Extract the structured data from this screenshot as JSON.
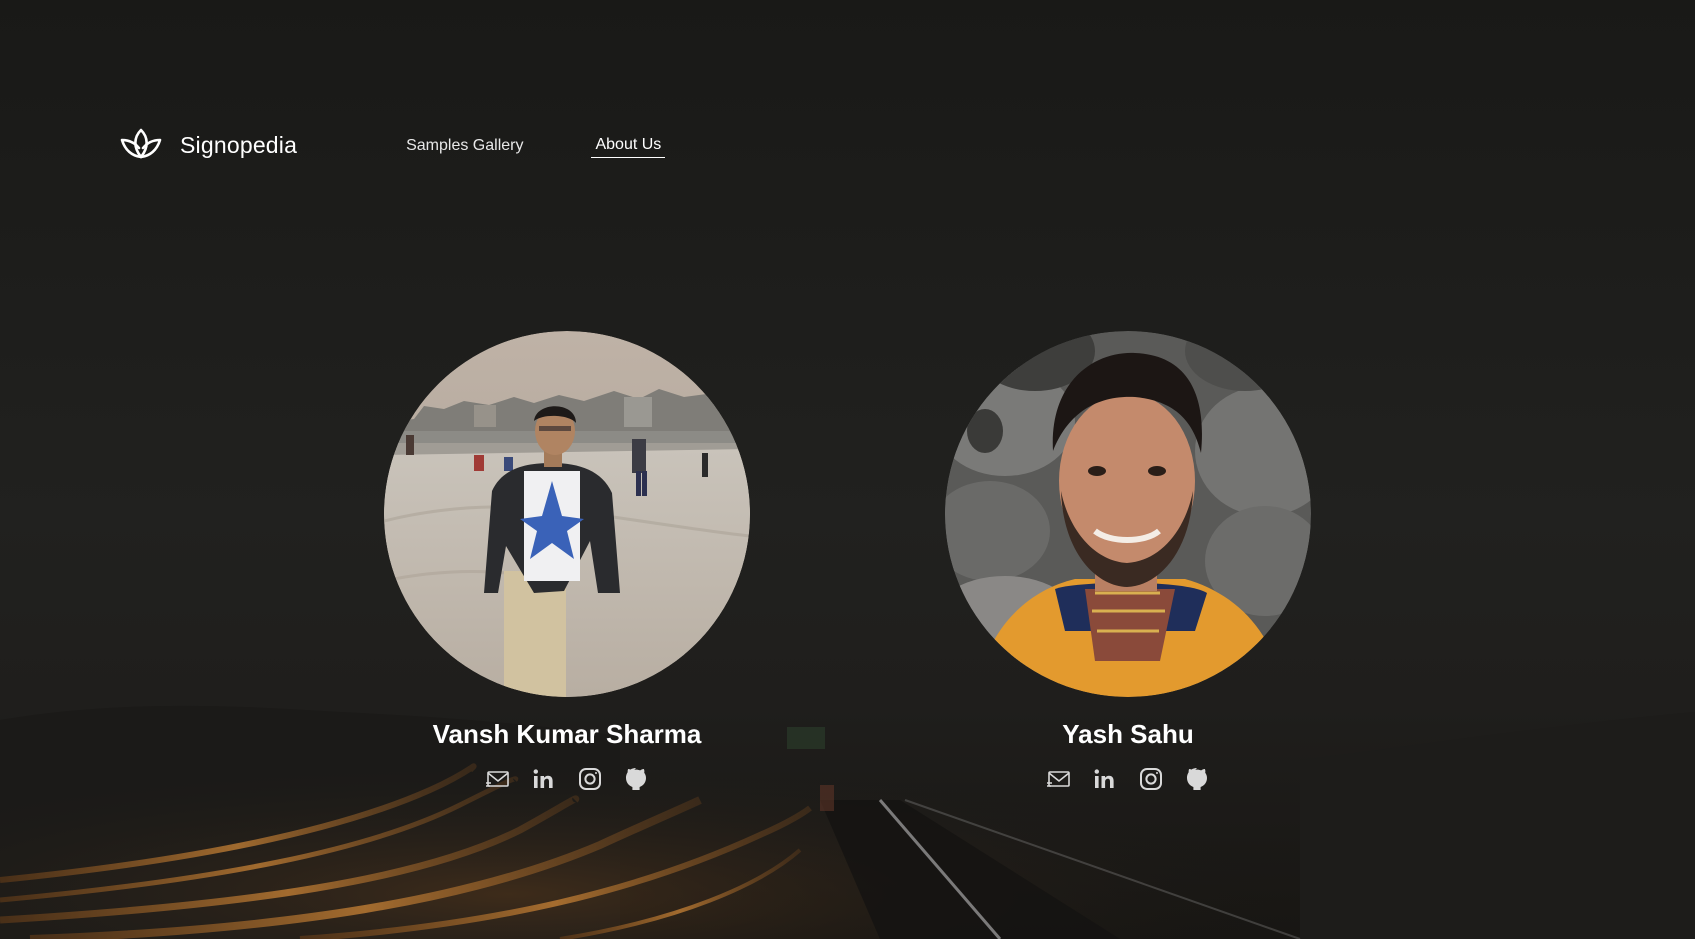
{
  "brand": {
    "name": "Signopedia",
    "logo_icon": "lotus-icon"
  },
  "nav": {
    "items": [
      {
        "label": "Samples Gallery",
        "active": false
      },
      {
        "label": "About Us",
        "active": true
      }
    ]
  },
  "team": {
    "members": [
      {
        "name": "Vansh Kumar Sharma",
        "photo": "beach-portrait-photo",
        "socials": [
          "mail-icon",
          "linkedin-icon",
          "instagram-icon",
          "github-icon"
        ]
      },
      {
        "name": "Yash Sahu",
        "photo": "rocks-selfie-photo",
        "socials": [
          "mail-icon",
          "linkedin-icon",
          "instagram-icon",
          "github-icon"
        ]
      }
    ]
  },
  "colors": {
    "background": "#1c1c1a",
    "text": "#ffffff",
    "icon": "#d9d9d9",
    "road_light": "#c77a2a"
  }
}
